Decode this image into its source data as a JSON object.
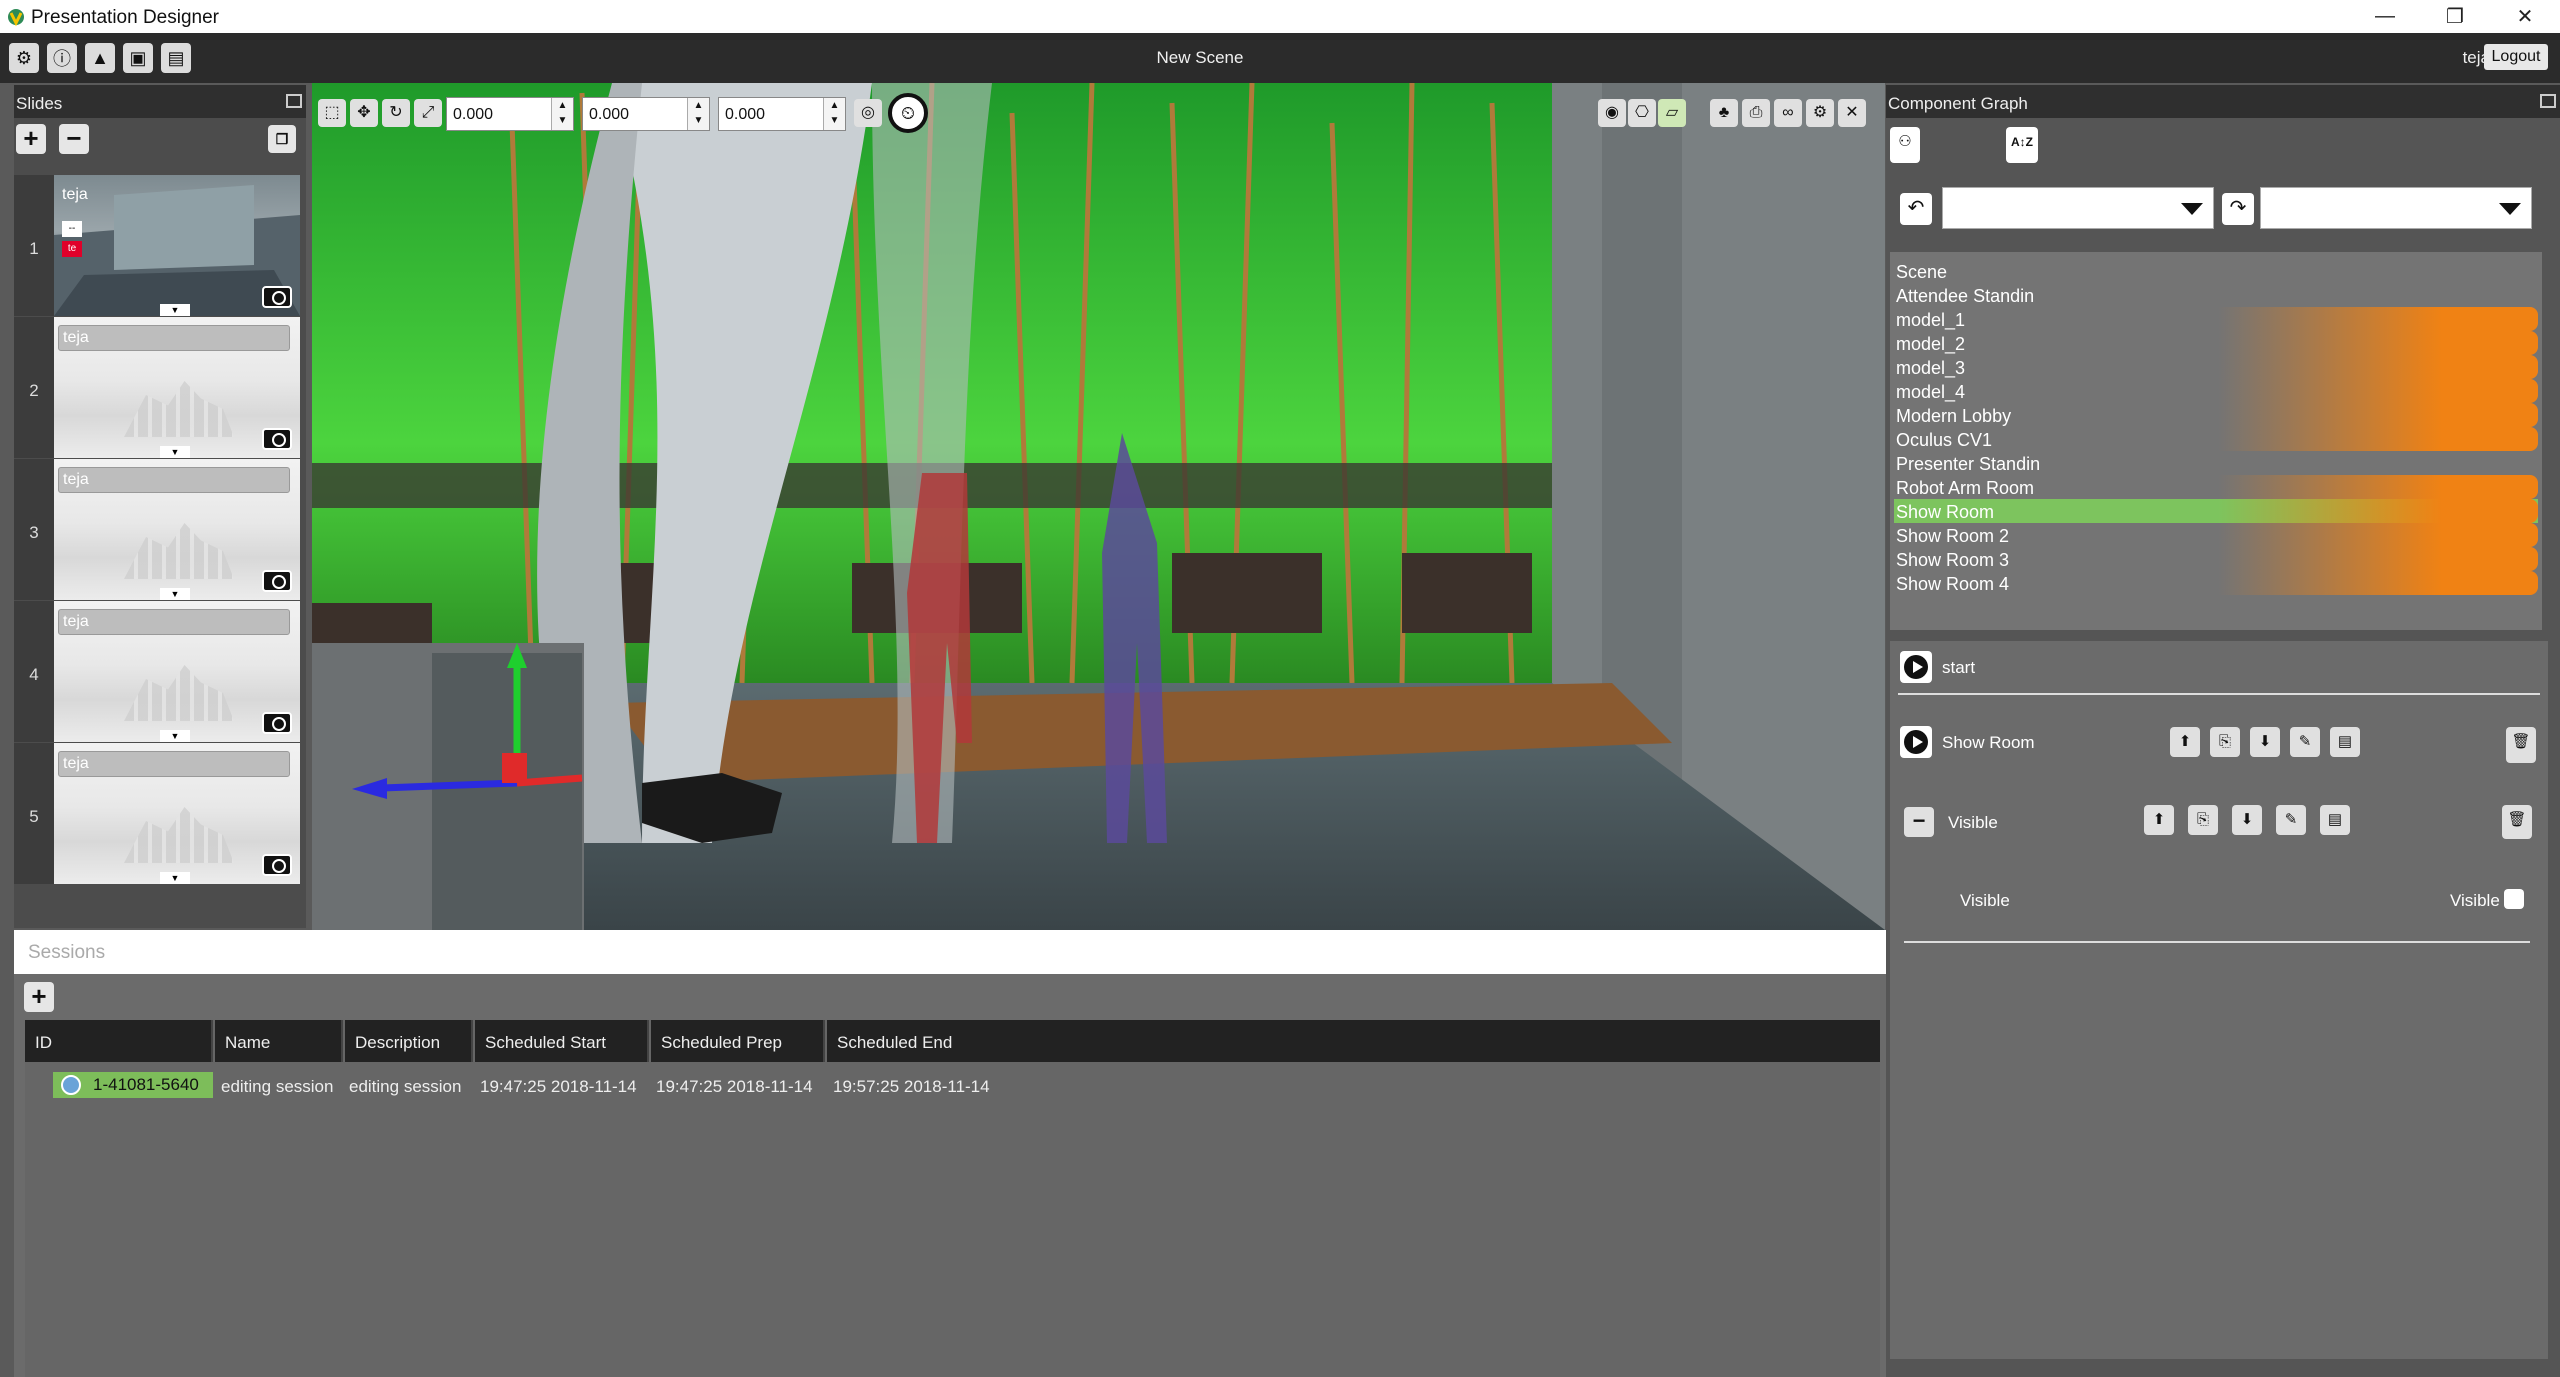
{
  "window": {
    "app_title": "Presentation Designer",
    "minimize": "—",
    "restore": "❐",
    "close": "✕"
  },
  "toolbar": {
    "scene_title": "New Scene",
    "user": "teja",
    "logout": "Logout",
    "icons": [
      "gear-icon",
      "info-icon",
      "graduation-cap-icon",
      "projector-icon",
      "presentation-board-icon"
    ]
  },
  "slides": {
    "header": "Slides",
    "add": "+",
    "remove": "−",
    "items": [
      {
        "number": "1",
        "label": "teja",
        "chip1": "--",
        "chip2": "te"
      },
      {
        "number": "2",
        "label": "teja"
      },
      {
        "number": "3",
        "label": "teja"
      },
      {
        "number": "4",
        "label": "teja"
      },
      {
        "number": "5",
        "label": "teja"
      }
    ]
  },
  "viewport": {
    "x_value": "0.000",
    "y_value": "0.000",
    "z_value": "0.000"
  },
  "sessions": {
    "header": "Sessions",
    "add": "+",
    "columns": [
      "ID",
      "Name",
      "Description",
      "Scheduled Start",
      "Scheduled Prep",
      "Scheduled End"
    ],
    "rows": [
      {
        "id": "1-41081-5640",
        "name": "editing session",
        "description": "editing session",
        "start": "19:47:25 2018-11-14",
        "prep": "19:47:25 2018-11-14",
        "end": "19:57:25 2018-11-14"
      }
    ]
  },
  "component_graph": {
    "header": "Component Graph",
    "sort_label": "A↕Z",
    "items": [
      {
        "label": "Scene",
        "highlight": false
      },
      {
        "label": "Attendee Standin",
        "highlight": false
      },
      {
        "label": "model_1",
        "highlight": true
      },
      {
        "label": "model_2",
        "highlight": true
      },
      {
        "label": "model_3",
        "highlight": true
      },
      {
        "label": "model_4",
        "highlight": true
      },
      {
        "label": "Modern Lobby",
        "highlight": true
      },
      {
        "label": "Oculus CV1",
        "highlight": true
      },
      {
        "label": "Presenter Standin",
        "highlight": false
      },
      {
        "label": "Robot Arm Room",
        "highlight": true
      },
      {
        "label": "Show Room",
        "highlight": true,
        "selected": true
      },
      {
        "label": "Show Room 2",
        "highlight": true
      },
      {
        "label": "Show Room 3",
        "highlight": true
      },
      {
        "label": "Show Room 4",
        "highlight": true
      }
    ],
    "actions": {
      "start": "start",
      "show_room": "Show Room",
      "visible_group": "Visible",
      "visible_label": "Visible",
      "visible_toggle_label": "Visible",
      "collapse": "−"
    }
  },
  "colors": {
    "selected_green": "#7dc45e",
    "highlight_orange": "#f08214",
    "session_id_green": "#7dbd5a"
  }
}
